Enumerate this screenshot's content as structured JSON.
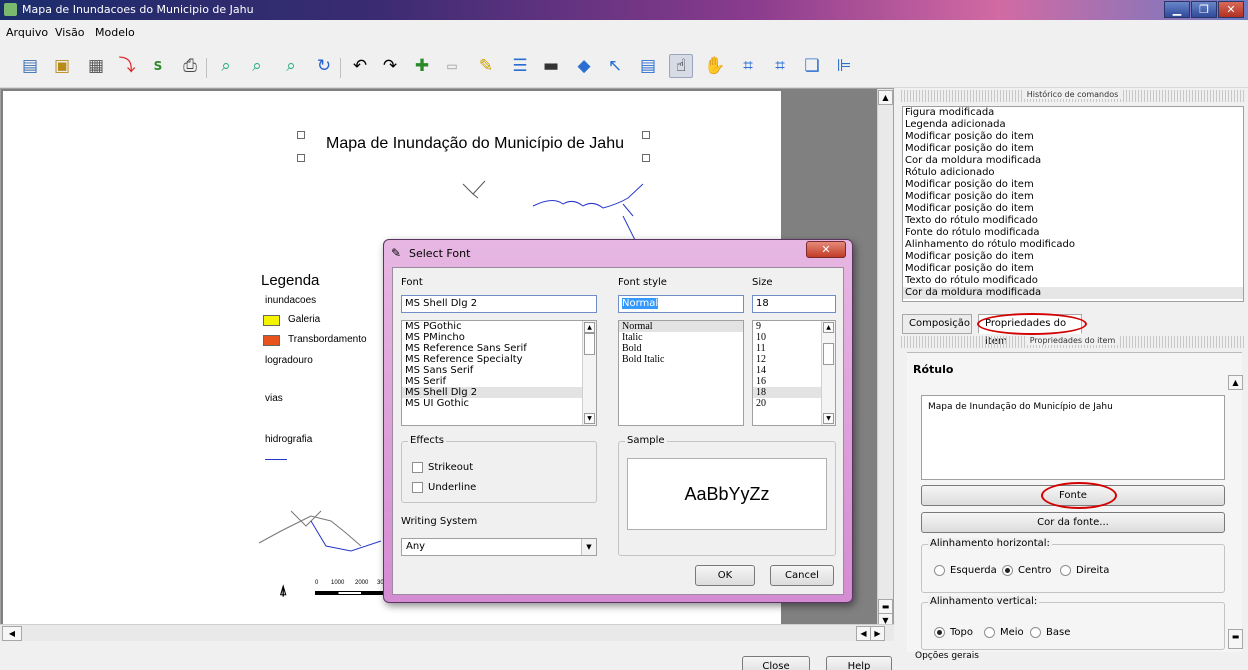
{
  "window": {
    "title": "Mapa de Inundacoes do Municipio de Jahu"
  },
  "menu": [
    "Arquivo",
    "Visão",
    "Modelo"
  ],
  "toolbar": [
    "open-folder-icon",
    "save-icon",
    "save-template-icon",
    "pdf-icon",
    "svg-icon",
    "print-icon",
    "zoom-full-icon",
    "zoom-in-icon",
    "zoom-out-icon",
    "refresh-icon",
    "undo-icon",
    "redo-icon",
    "add-map-icon",
    "add-image-icon",
    "add-label-icon",
    "add-legend-icon",
    "add-scalebar-icon",
    "add-shape-icon",
    "add-arrow-icon",
    "add-table-icon",
    "select-move-icon",
    "move-content-icon",
    "group-icon",
    "ungroup-icon",
    "raise-icon",
    "align-icon"
  ],
  "map": {
    "title": "Mapa de Inundação do Município de Jahu",
    "legend": {
      "title": "Legenda",
      "layers": [
        "inundacoes",
        "logradouro",
        "vias",
        "hidrografia"
      ],
      "items": [
        {
          "label": "Galeria",
          "color": "#f4f400"
        },
        {
          "label": "Transbordamento",
          "color": "#e8531b"
        }
      ]
    },
    "scale_labels": [
      "0",
      "1000",
      "2000",
      "30"
    ]
  },
  "dialog": {
    "title": "Select Font",
    "font_label": "Font",
    "font_value": "MS Shell Dlg 2",
    "style_label": "Font style",
    "style_value": "Normal",
    "size_label": "Size",
    "size_value": "18",
    "fonts": [
      "MS PGothic",
      "MS PMincho",
      "MS Reference Sans Serif",
      "MS Reference Specialty",
      "MS Sans Serif",
      "MS Serif",
      "MS Shell Dlg 2",
      "MS UI Gothic"
    ],
    "styles": [
      "Normal",
      "Italic",
      "Bold",
      "Bold Italic"
    ],
    "sizes": [
      "9",
      "10",
      "11",
      "12",
      "14",
      "16",
      "18",
      "20"
    ],
    "effects_label": "Effects",
    "strikeout": "Strikeout",
    "underline": "Underline",
    "sample_label": "Sample",
    "sample_text": "AaBbYyZz",
    "writing_system_label": "Writing System",
    "writing_system_value": "Any",
    "ok": "OK",
    "cancel": "Cancel"
  },
  "panel": {
    "history_title": "Histórico de comandos",
    "history": [
      "Figura modificada",
      "Legenda adicionada",
      "Modificar posição do item",
      "Modificar posição do item",
      "Cor da moldura modificada",
      "Rótulo adicionado",
      "Modificar posição do item",
      "Modificar posição do item",
      "Modificar posição do item",
      "Texto do rótulo modificado",
      "Fonte do rótulo modificada",
      "Alinhamento do rótulo modificado",
      "Modificar posição do item",
      "Modificar posição do item",
      "Texto do rótulo modificado",
      "Cor da moldura modificada"
    ],
    "tab_composition": "Composição",
    "tab_item_props": "Propriedades do item",
    "item_props_title": "Propriedades do item",
    "section_label": "Rótulo",
    "label_text": "Mapa de Inundação do Município de Jahu",
    "font_button": "Fonte",
    "font_color_button": "Cor da fonte...",
    "halign_label": "Alinhamento horizontal:",
    "halign_options": [
      "Esquerda",
      "Centro",
      "Direita"
    ],
    "valign_label": "Alinhamento vertical:",
    "valign_options": [
      "Topo",
      "Meio",
      "Base"
    ],
    "general_options": "Opções gerais"
  },
  "footer": {
    "close": "Close",
    "help": "Help"
  },
  "colors": {
    "highlight_ring": "#d20000",
    "dialog_frame": "#d48bd2"
  }
}
